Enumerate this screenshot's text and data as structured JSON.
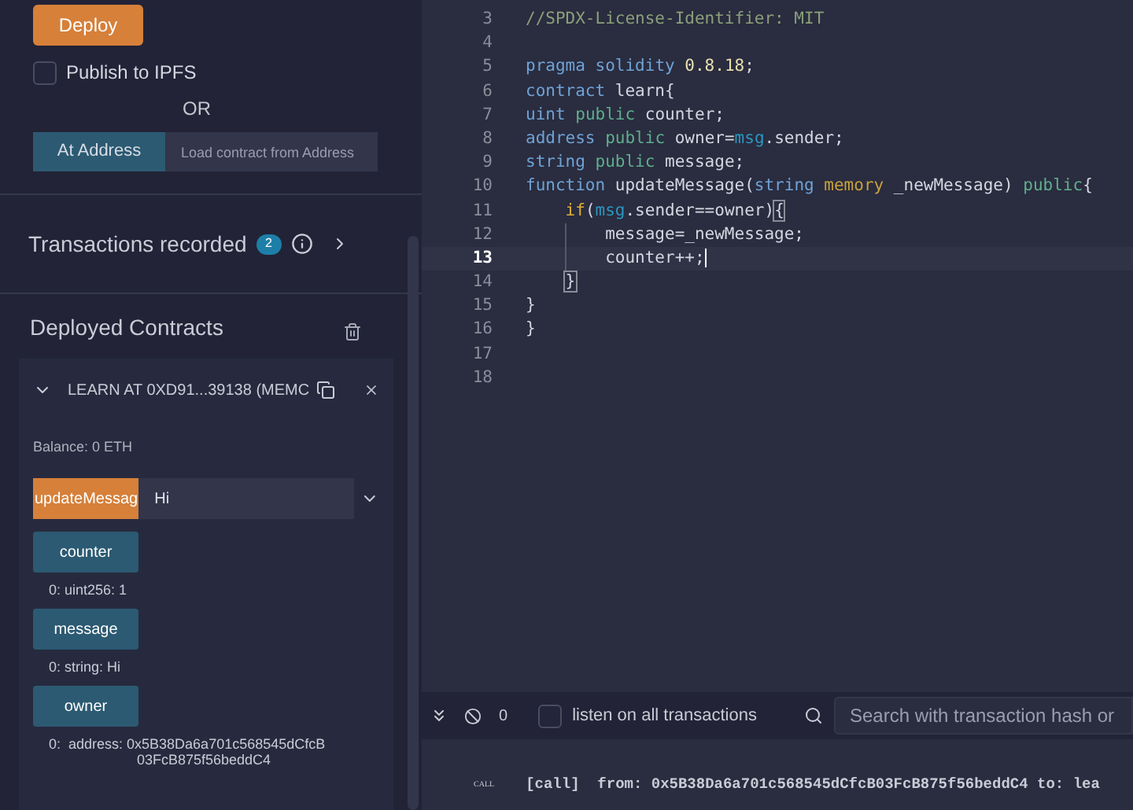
{
  "deploy": {
    "button": "Deploy",
    "publish": {
      "label": "Publish to IPFS",
      "checked": false
    },
    "or": "OR",
    "at_address": {
      "button": "At Address",
      "placeholder": "Load contract from Address"
    }
  },
  "transactions": {
    "title": "Transactions recorded",
    "count": "2"
  },
  "deployed": {
    "title": "Deployed Contracts",
    "contract": {
      "title": "LEARN AT 0XD91...39138 (MEMC",
      "expanded": true,
      "balance": "Balance: 0 ETH",
      "functions": [
        {
          "kind": "transact",
          "name": "updateMessag",
          "value": "Hi"
        },
        {
          "kind": "call",
          "name": "counter",
          "result": [
            "0: uint256: 1"
          ]
        },
        {
          "kind": "call",
          "name": "message",
          "result": [
            "0: string: Hi"
          ]
        },
        {
          "kind": "call",
          "name": "owner",
          "result": [
            "0:  address: 0x5B38Da6a701c568545dCfcB",
            "03FcB875f56beddC4"
          ]
        }
      ]
    }
  },
  "editor": {
    "lines": [
      {
        "number": "3",
        "active": false,
        "tokens": [
          {
            "kind": "comment",
            "text": "//SPDX-License-Identifier: MIT"
          }
        ]
      },
      {
        "number": "4",
        "active": false
      },
      {
        "number": "5",
        "active": false,
        "tokens": [
          {
            "kind": "keyword",
            "text": "pragma"
          },
          {
            "kind": "keyword",
            "text": " solidity"
          },
          {
            "kind": "number",
            "text": " 0.8.18"
          },
          {
            "kind": "plain",
            "text": ";"
          }
        ]
      },
      {
        "number": "6",
        "active": false,
        "tokens": [
          {
            "kind": "keyword",
            "text": "contract"
          },
          {
            "kind": "plain",
            "text": " learn{"
          }
        ]
      },
      {
        "number": "7",
        "active": false,
        "tokens": [
          {
            "kind": "keyword",
            "text": "uint"
          },
          {
            "kind": "modifier",
            "text": " public"
          },
          {
            "kind": "plain",
            "text": " counter;"
          }
        ]
      },
      {
        "number": "8",
        "active": false,
        "tokens": [
          {
            "kind": "keyword",
            "text": "address"
          },
          {
            "kind": "modifier",
            "text": " public"
          },
          {
            "kind": "plain",
            "text": " owner="
          },
          {
            "kind": "builtin",
            "text": "msg"
          },
          {
            "kind": "plain",
            "text": ".sender;"
          }
        ]
      },
      {
        "number": "9",
        "active": false,
        "tokens": [
          {
            "kind": "keyword",
            "text": "string"
          },
          {
            "kind": "modifier",
            "text": " public"
          },
          {
            "kind": "plain",
            "text": " message;"
          }
        ]
      },
      {
        "number": "10",
        "active": false,
        "tokens": [
          {
            "kind": "keyword",
            "text": "function"
          },
          {
            "kind": "plain",
            "text": " updateMessage("
          },
          {
            "kind": "keyword",
            "text": "string"
          },
          {
            "kind": "storage",
            "text": " memory"
          },
          {
            "kind": "plain",
            "text": " _newMessage)"
          },
          {
            "kind": "modifier",
            "text": " public"
          },
          {
            "kind": "plain",
            "text": "{"
          }
        ],
        "children": [
          {
            "number": "11",
            "active": false,
            "tokens": [
              {
                "kind": "control",
                "text": "if"
              },
              {
                "kind": "plain",
                "text": "("
              },
              {
                "kind": "builtin",
                "text": "msg"
              },
              {
                "kind": "plain",
                "text": ".sender==owner)"
              },
              {
                "kind": "match",
                "text": "{"
              }
            ],
            "children": [
              {
                "number": "12",
                "active": false,
                "tokens": [
                  {
                    "kind": "plain",
                    "text": "message=_newMessage;"
                  }
                ]
              },
              {
                "number": "13",
                "active": true,
                "tokens": [
                  {
                    "kind": "plain",
                    "text": "counter++;"
                  }
                ]
              }
            ]
          },
          {
            "number": "14",
            "active": false,
            "tokens": [
              {
                "kind": "match",
                "text": "}"
              }
            ]
          }
        ]
      },
      {
        "number": "15",
        "active": false,
        "tokens": [
          {
            "kind": "plain",
            "text": "}"
          }
        ]
      },
      {
        "number": "16",
        "active": false,
        "tokens": [
          {
            "kind": "plain",
            "text": "}"
          }
        ]
      },
      {
        "number": "17",
        "active": false
      },
      {
        "number": "18",
        "active": false
      }
    ]
  },
  "terminal": {
    "count": "0",
    "listen": {
      "label": "listen on all transactions",
      "checked": false
    },
    "search_placeholder": "Search with transaction hash or",
    "log": {
      "tag": "CALL",
      "text": "[call]  from: 0x5B38Da6a701c568545dCfcB03FcB875f56beddC4 to: lea"
    }
  }
}
